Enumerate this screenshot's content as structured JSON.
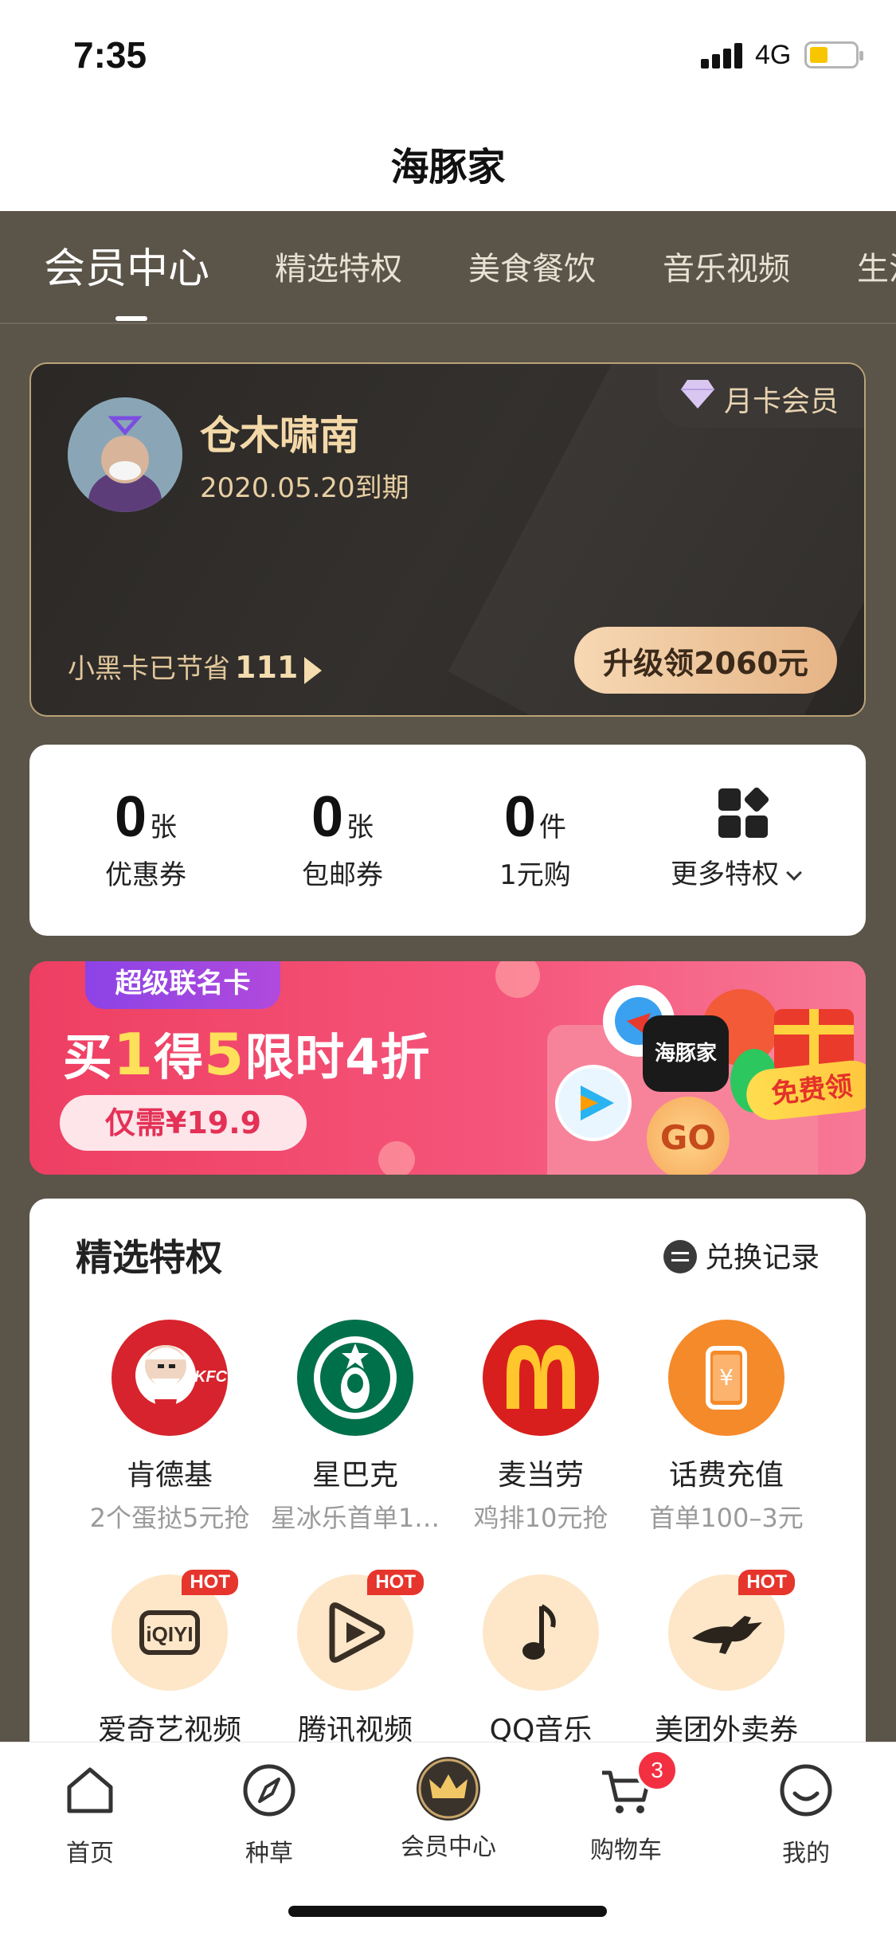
{
  "status_bar": {
    "time": "7:35",
    "network": "4G"
  },
  "nav": {
    "title": "海豚家"
  },
  "tabs": [
    {
      "label": "会员中心",
      "active": true
    },
    {
      "label": "精选特权"
    },
    {
      "label": "美食餐饮"
    },
    {
      "label": "音乐视频"
    },
    {
      "label": "生活"
    }
  ],
  "member": {
    "name": "仓木啸南",
    "expiry": "2020.05.20到期",
    "badge": "月卡会员",
    "savings_label": "小黑卡已节省",
    "savings_value": "111",
    "upgrade_label": "升级领2060元"
  },
  "stats": [
    {
      "value": "0",
      "unit": "张",
      "label": "优惠券"
    },
    {
      "value": "0",
      "unit": "张",
      "label": "包邮券"
    },
    {
      "value": "0",
      "unit": "件",
      "label": "1元购"
    }
  ],
  "more_privileges": "更多特权",
  "banner": {
    "tag": "超级联名卡",
    "headline_a": "买",
    "headline_b": "1",
    "headline_c": "得",
    "headline_d": "5",
    "headline_e": "限时4折",
    "price": "仅需¥19.9",
    "brand": "海豚家",
    "go": "GO",
    "free": "免费领"
  },
  "privileges": {
    "title": "精选特权",
    "exchange_label": "兑换记录",
    "items": [
      {
        "name": "肯德基",
        "desc": "2个蛋挞5元抢",
        "icon": "kfc-logo",
        "color": "#d7232d"
      },
      {
        "name": "星巴克",
        "desc": "星冰乐首单1…",
        "icon": "starbucks-logo",
        "color": "#00704a"
      },
      {
        "name": "麦当劳",
        "desc": "鸡排10元抢",
        "icon": "mcdonalds-logo",
        "color": "#d81f1d"
      },
      {
        "name": "话费充值",
        "desc": "首单100–3元",
        "icon": "phone-recharge-icon",
        "color": "#f58a2a"
      },
      {
        "name": "爱奇艺视频",
        "desc": "",
        "icon": "iqiyi-logo",
        "hot": "HOT"
      },
      {
        "name": "腾讯视频",
        "desc": "",
        "icon": "tencent-video-logo",
        "hot": "HOT"
      },
      {
        "name": "QQ音乐",
        "desc": "",
        "icon": "qq-music-logo"
      },
      {
        "name": "美团外卖券",
        "desc": "",
        "icon": "meituan-kangaroo-logo",
        "hot": "HOT"
      }
    ]
  },
  "tabbar": [
    {
      "label": "首页",
      "icon": "home-icon"
    },
    {
      "label": "种草",
      "icon": "compass-icon"
    },
    {
      "label": "会员中心",
      "icon": "crown-icon",
      "active": true
    },
    {
      "label": "购物车",
      "icon": "cart-icon",
      "badge": "3"
    },
    {
      "label": "我的",
      "icon": "smile-icon"
    }
  ]
}
